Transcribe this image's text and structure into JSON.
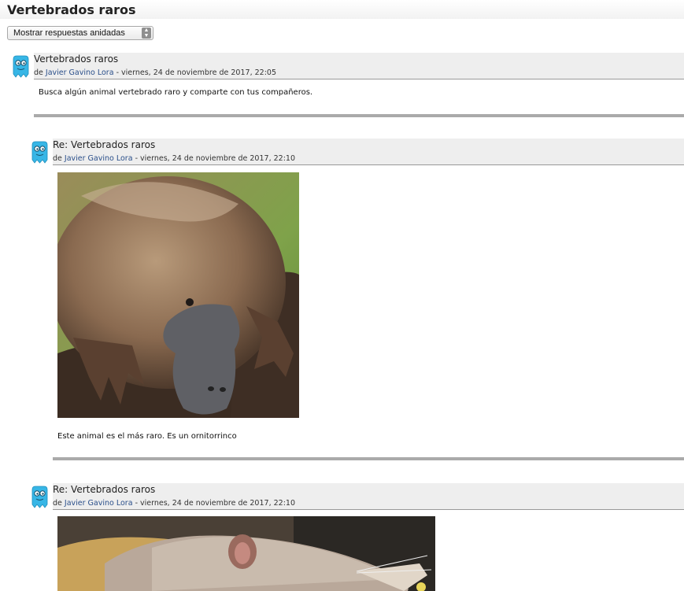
{
  "page": {
    "title": "Vertebrados raros"
  },
  "display_mode": {
    "selected": "Mostrar respuestas anidadas"
  },
  "posts": [
    {
      "subject": "Vertebrados raros",
      "by": "de",
      "author": "Javier Gavino Lora",
      "date": "- viernes, 24 de noviembre de 2017, 22:05",
      "message": "Busca algún animal vertebrado raro y comparte con tus compañeros."
    },
    {
      "subject": "Re: Vertebrados raros",
      "by": "de",
      "author": "Javier Gavino Lora",
      "date": "- viernes, 24 de noviembre de 2017, 22:10",
      "message": "Este animal es el más raro. Es un ornitorrinco"
    },
    {
      "subject": "Re: Vertebrados raros",
      "by": "de",
      "author": "Javier Gavino Lora",
      "date": "- viernes, 24 de noviembre de 2017, 22:10",
      "message": ""
    }
  ]
}
